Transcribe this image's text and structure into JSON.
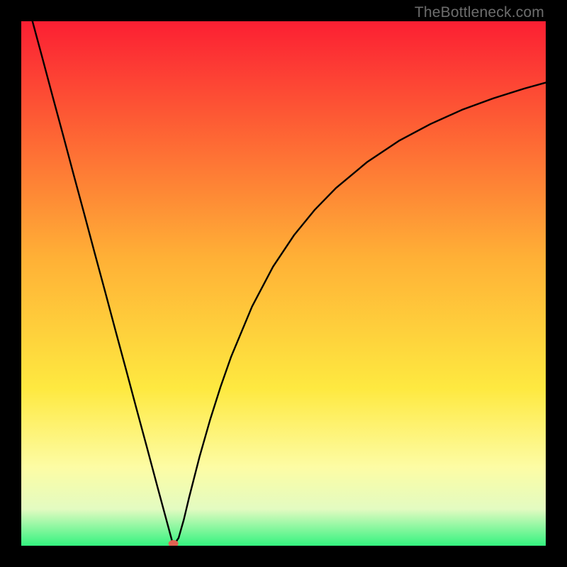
{
  "watermark": "TheBottleneck.com",
  "colors": {
    "bg": "#000000",
    "grad_top": "#fc1f33",
    "grad_mid1": "#ff8f2b",
    "grad_mid2": "#fee940",
    "grad_mid3": "#fdfca4",
    "grad_mid4": "#e3fbc1",
    "grad_bot": "#34f37f",
    "curve": "#000000",
    "marker": "#e16252"
  },
  "chart_data": {
    "type": "line",
    "title": "",
    "xlabel": "",
    "ylabel": "",
    "xlim": [
      0,
      100
    ],
    "ylim": [
      0,
      100
    ],
    "series": [
      {
        "name": "curve",
        "x": [
          0,
          2,
          4,
          6,
          8,
          10,
          12,
          14,
          16,
          18,
          20,
          22,
          24,
          26,
          28,
          29,
          30,
          31,
          32,
          34,
          36,
          38,
          40,
          44,
          48,
          52,
          56,
          60,
          66,
          72,
          78,
          84,
          90,
          96,
          100
        ],
        "y": [
          108,
          100.5,
          93.1,
          85.6,
          78.2,
          70.7,
          63.3,
          55.8,
          48.4,
          40.9,
          33.5,
          26.0,
          18.6,
          11.1,
          3.7,
          0.0,
          1.5,
          5.0,
          9.2,
          17.0,
          24.0,
          30.3,
          36.0,
          45.6,
          53.2,
          59.2,
          64.1,
          68.2,
          73.2,
          77.2,
          80.4,
          83.1,
          85.3,
          87.2,
          88.3
        ]
      }
    ],
    "marker": {
      "x": 29,
      "y": 0
    },
    "gradient_stops": [
      {
        "pos": 0.0,
        "color": "#fc1f33"
      },
      {
        "pos": 0.45,
        "color": "#ffb036"
      },
      {
        "pos": 0.7,
        "color": "#fee940"
      },
      {
        "pos": 0.85,
        "color": "#fdfca4"
      },
      {
        "pos": 0.93,
        "color": "#e3fbc1"
      },
      {
        "pos": 1.0,
        "color": "#34f37f"
      }
    ]
  }
}
